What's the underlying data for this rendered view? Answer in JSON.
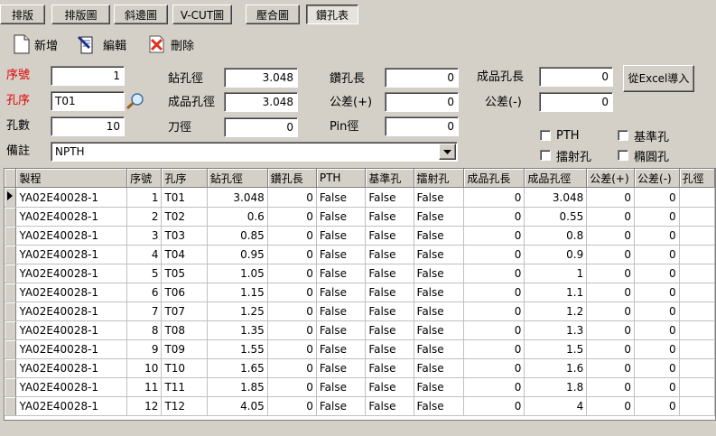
{
  "tabs": [
    {
      "label": "排版",
      "active": false
    },
    {
      "label": "排版圖",
      "active": false
    },
    {
      "label": "斜邊圖",
      "active": false
    },
    {
      "label": "V-CUT圖",
      "active": false
    },
    {
      "label": "壓合圖",
      "active": false
    },
    {
      "label": "鑽孔表",
      "active": true
    }
  ],
  "toolbar": {
    "new_label": "新增",
    "edit_label": "編輯",
    "delete_label": "刪除"
  },
  "form": {
    "seq_label": "序號",
    "seq_value": "1",
    "hole_order_label": "孔序",
    "hole_order_value": "T01",
    "hole_count_label": "孔數",
    "hole_count_value": "10",
    "remark_label": "備註",
    "remark_value": "NPTH",
    "drill_dia_label": "鉆孔徑",
    "drill_dia_value": "3.048",
    "finish_dia_label": "成品孔徑",
    "finish_dia_value": "3.048",
    "blade_dia_label": "刀徑",
    "blade_dia_value": "0",
    "drill_len_label": "鑽孔長",
    "drill_len_value": "0",
    "tol_plus_label": "公差(+)",
    "tol_plus_value": "0",
    "pin_dia_label": "Pin徑",
    "pin_dia_value": "0",
    "finish_len_label": "成品孔長",
    "finish_len_value": "0",
    "tol_minus_label": "公差(-)",
    "tol_minus_value": "0",
    "excel_button_label": "從Excel導入",
    "checkboxes": {
      "pth": "PTH",
      "datum": "基準孔",
      "laser": "擂射孔",
      "oval": "橢圓孔"
    }
  },
  "table": {
    "columns": [
      "製程",
      "序號",
      "孔序",
      "鉆孔徑",
      "鑽孔長",
      "PTH",
      "基準孔",
      "擂射孔",
      "成品孔長",
      "成品孔徑",
      "公差(+)",
      "公差(-)",
      "孔徑"
    ],
    "rows": [
      [
        "YA02E40028-1",
        "1",
        "T01",
        "3.048",
        "0",
        "False",
        "False",
        "False",
        "0",
        "3.048",
        "0",
        "0"
      ],
      [
        "YA02E40028-1",
        "2",
        "T02",
        "0.6",
        "0",
        "False",
        "False",
        "False",
        "0",
        "0.55",
        "0",
        "0"
      ],
      [
        "YA02E40028-1",
        "3",
        "T03",
        "0.85",
        "0",
        "False",
        "False",
        "False",
        "0",
        "0.8",
        "0",
        "0"
      ],
      [
        "YA02E40028-1",
        "4",
        "T04",
        "0.95",
        "0",
        "False",
        "False",
        "False",
        "0",
        "0.9",
        "0",
        "0"
      ],
      [
        "YA02E40028-1",
        "5",
        "T05",
        "1.05",
        "0",
        "False",
        "False",
        "False",
        "0",
        "1",
        "0",
        "0"
      ],
      [
        "YA02E40028-1",
        "6",
        "T06",
        "1.15",
        "0",
        "False",
        "False",
        "False",
        "0",
        "1.1",
        "0",
        "0"
      ],
      [
        "YA02E40028-1",
        "7",
        "T07",
        "1.25",
        "0",
        "False",
        "False",
        "False",
        "0",
        "1.2",
        "0",
        "0"
      ],
      [
        "YA02E40028-1",
        "8",
        "T08",
        "1.35",
        "0",
        "False",
        "False",
        "False",
        "0",
        "1.3",
        "0",
        "0"
      ],
      [
        "YA02E40028-1",
        "9",
        "T09",
        "1.55",
        "0",
        "False",
        "False",
        "False",
        "0",
        "1.5",
        "0",
        "0"
      ],
      [
        "YA02E40028-1",
        "10",
        "T10",
        "1.65",
        "0",
        "False",
        "False",
        "False",
        "0",
        "1.6",
        "0",
        "0"
      ],
      [
        "YA02E40028-1",
        "11",
        "T11",
        "1.85",
        "0",
        "False",
        "False",
        "False",
        "0",
        "1.8",
        "0",
        "0"
      ],
      [
        "YA02E40028-1",
        "12",
        "T12",
        "4.05",
        "0",
        "False",
        "False",
        "False",
        "0",
        "4",
        "0",
        "0"
      ]
    ]
  },
  "colors": {
    "required_label": "#e00000",
    "window": "#d4d0c8"
  }
}
